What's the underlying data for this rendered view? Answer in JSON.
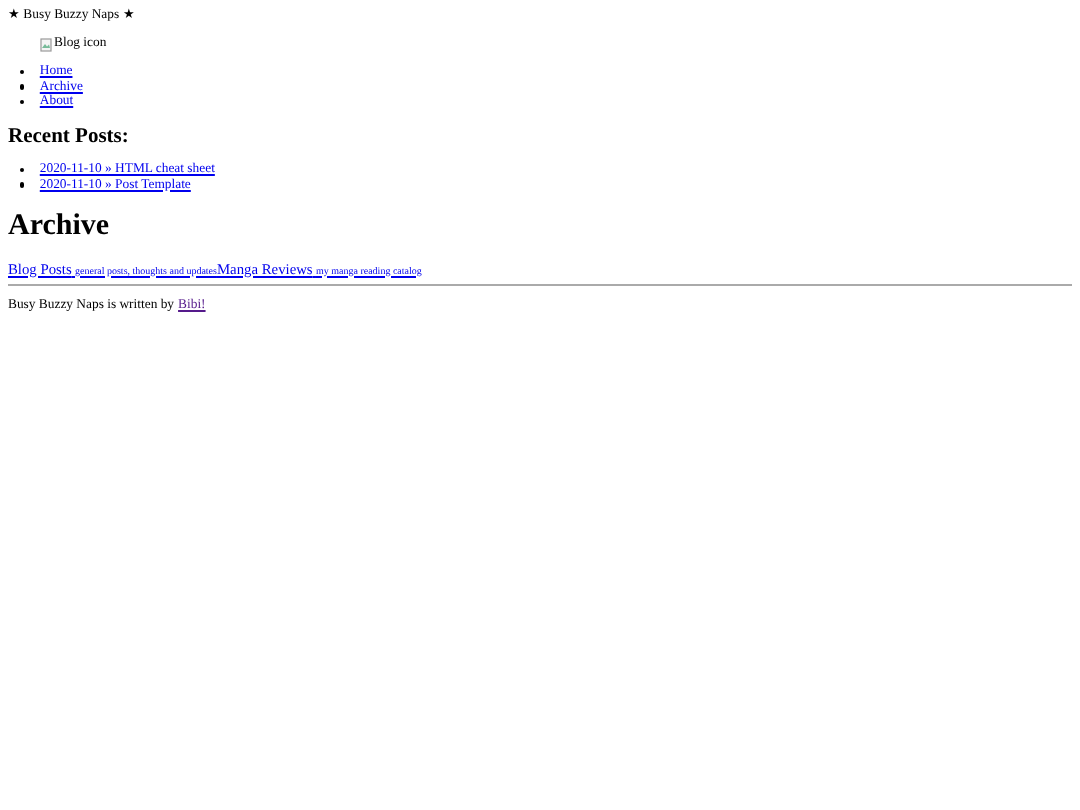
{
  "site_title": "★ Busy Buzzy Naps ★",
  "logo": {
    "alt": "Blog icon"
  },
  "nav": [
    {
      "label": "Home",
      "visited": false
    },
    {
      "label": "Archive",
      "visited": false
    },
    {
      "label": "About",
      "visited": false
    }
  ],
  "recent_posts": {
    "heading": "Recent Posts:",
    "items": [
      {
        "label": "2020-11-10 » HTML cheat sheet",
        "visited": false
      },
      {
        "label": "2020-11-10 » Post Template",
        "visited": false
      }
    ]
  },
  "page_heading": "Archive",
  "categories": [
    {
      "title": "Blog Posts",
      "description": "general posts, thoughts and updates",
      "visited": false
    },
    {
      "title": "Manga Reviews",
      "description": "my manga reading catalog",
      "visited": false
    }
  ],
  "footer": {
    "text": "Busy Buzzy Naps is written by",
    "author_link": {
      "label": "Bibi!",
      "visited": true
    }
  }
}
